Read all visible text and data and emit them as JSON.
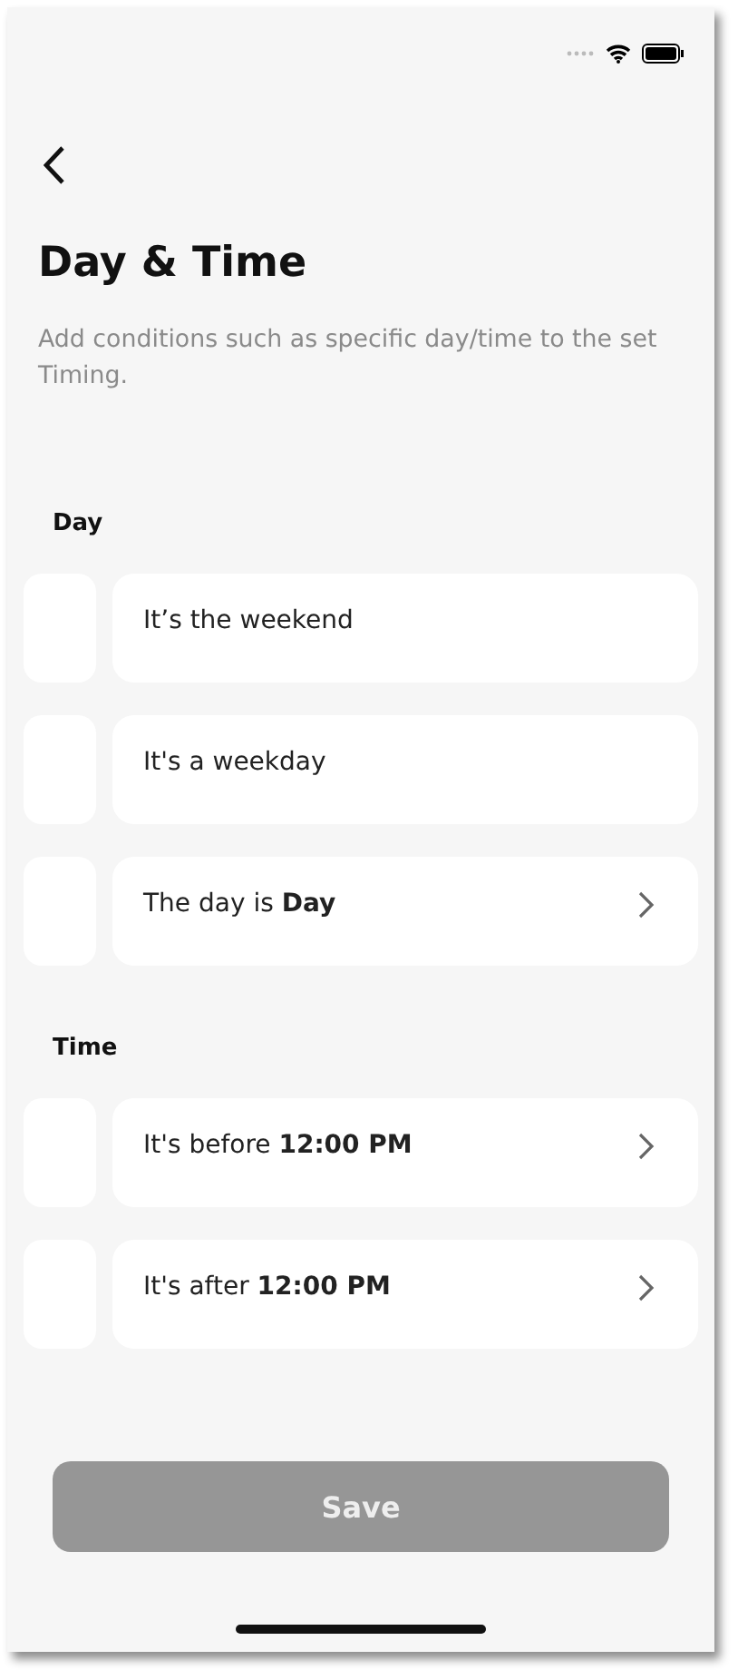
{
  "title": "Day & Time",
  "description": "Add conditions such as specific day/time to the set Timing.",
  "sections": [
    {
      "label": "Day",
      "options": [
        {
          "text": "It’s the weekend",
          "checked": false,
          "chevron": false
        },
        {
          "text": "It's a weekday",
          "checked": false,
          "chevron": false
        },
        {
          "text": "The day is **Day**",
          "checked": false,
          "chevron": true
        }
      ]
    },
    {
      "label": "Time",
      "options": [
        {
          "text": "It's before **12:00 PM**",
          "checked": false,
          "chevron": true
        },
        {
          "text": "It's after **12:00 PM**",
          "checked": false,
          "chevron": true
        }
      ]
    }
  ],
  "save": {
    "label": "Save",
    "disabled": true
  }
}
